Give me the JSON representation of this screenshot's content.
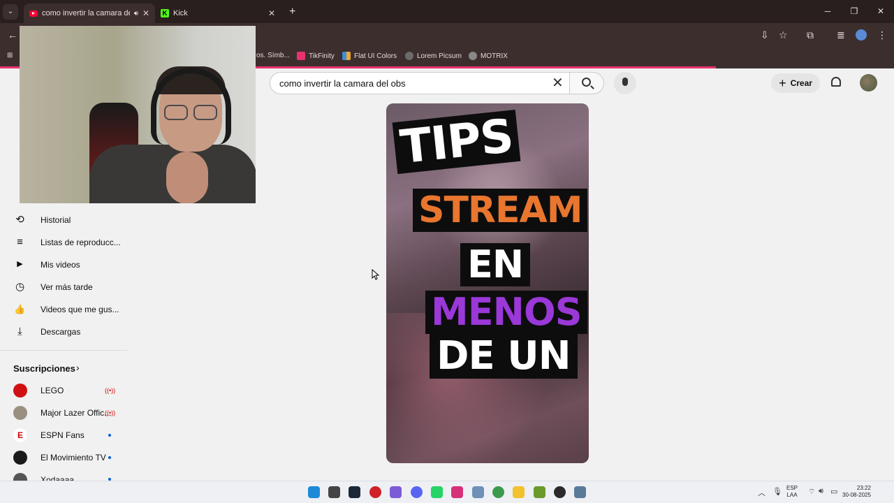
{
  "browser": {
    "tabs": [
      {
        "title": "como invertir la camara del obs",
        "active": true
      },
      {
        "title": "Kick",
        "active": false
      }
    ],
    "bookmarks": [
      {
        "label": "os. Símb...",
        "color": "#3d2e2e"
      },
      {
        "label": "TikFinity",
        "color": "#e8326f"
      },
      {
        "label": "Flat UI Colors",
        "color": "#3a8fd9"
      },
      {
        "label": "Lorem Picsum",
        "color": "#6b6b6b"
      },
      {
        "label": "MOTRIX",
        "color": "#888888"
      }
    ]
  },
  "youtube": {
    "search_value": "como invertir la camara del obs",
    "create_label": "Crear"
  },
  "sidebar": {
    "items": [
      {
        "label": "Historial",
        "icon": "history-icon",
        "glyph": "⟲"
      },
      {
        "label": "Listas de reproducc...",
        "icon": "playlist-icon",
        "glyph": "≡"
      },
      {
        "label": "Mis videos",
        "icon": "my-videos-icon",
        "glyph": "▶"
      },
      {
        "label": "Ver más tarde",
        "icon": "watch-later-icon",
        "glyph": "◷"
      },
      {
        "label": "Videos que me gus...",
        "icon": "like-icon",
        "glyph": "👍"
      },
      {
        "label": "Descargas",
        "icon": "download-icon",
        "glyph": "⤓"
      }
    ],
    "subscriptions_title": "Suscripciones",
    "subscriptions": [
      {
        "name": "LEGO",
        "status": "live",
        "color": "#d01012"
      },
      {
        "name": "Major Lazer Offic...",
        "status": "live",
        "color": "#9a9080"
      },
      {
        "name": "ESPN Fans",
        "status": "new",
        "color": "#cc0000"
      },
      {
        "name": "El Movimiento TV",
        "status": "new",
        "color": "#1a1a1a"
      },
      {
        "name": "Xodaaaa",
        "status": "new",
        "color": "#555555"
      }
    ]
  },
  "short": {
    "captions": [
      "TIPS",
      "STREAM",
      "EN",
      "MENOS",
      "DE UN"
    ]
  },
  "tray": {
    "lang_top": "ESP",
    "lang_bottom": "LAA",
    "time": "23:22",
    "date": "30-08-2025"
  },
  "taskbar_apps": [
    {
      "name": "windows-start-icon",
      "color": "#1e8ad6"
    },
    {
      "name": "file-app-icon",
      "color": "#444444"
    },
    {
      "name": "steam-icon",
      "color": "#1b2838"
    },
    {
      "name": "record-app-icon",
      "color": "#d0202a"
    },
    {
      "name": "atom-app-icon",
      "color": "#7c5cd6"
    },
    {
      "name": "discord-icon",
      "color": "#5865f2"
    },
    {
      "name": "whatsapp-icon",
      "color": "#25d366"
    },
    {
      "name": "instagram-icon",
      "color": "#d6307a"
    },
    {
      "name": "photos-icon",
      "color": "#6f8fb8"
    },
    {
      "name": "chrome-icon",
      "color": "#3c9a4a"
    },
    {
      "name": "explorer-icon",
      "color": "#f2c12e"
    },
    {
      "name": "app-green-icon",
      "color": "#6a9a2a"
    },
    {
      "name": "obs-icon",
      "color": "#2a2a2a"
    },
    {
      "name": "settings-icon",
      "color": "#5a7a9a"
    }
  ]
}
